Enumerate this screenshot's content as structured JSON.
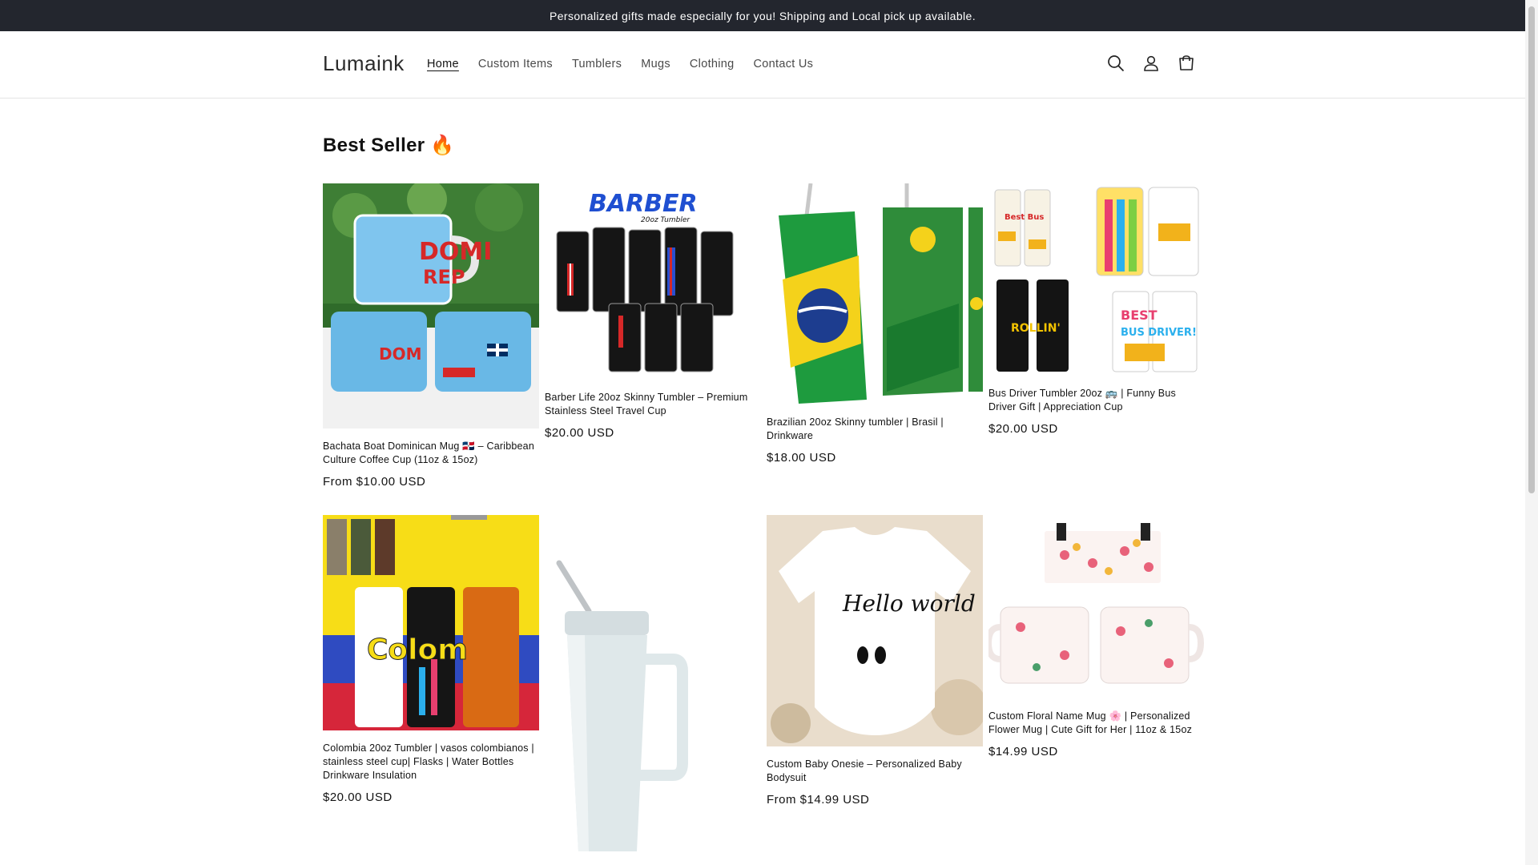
{
  "announcement": "Personalized gifts made especially for you! Shipping and Local pick up available.",
  "header": {
    "logo": "Lumaink",
    "nav": [
      "Home",
      "Custom Items",
      "Tumblers",
      "Mugs",
      "Clothing",
      "Contact Us"
    ],
    "icons": [
      "search-icon",
      "account-icon",
      "cart-icon"
    ]
  },
  "section": {
    "title": "Best Seller 🔥"
  },
  "products": [
    {
      "title": "Bachata Boat Dominican Mug 🇩🇴 – Caribbean Culture Coffee Cup (11oz & 15oz)",
      "price": "From $10.00 USD"
    },
    {
      "title": "Barber Life 20oz Skinny Tumbler – Premium Stainless Steel Travel Cup",
      "price": "$20.00 USD"
    },
    {
      "title": "Brazilian 20oz Skinny tumbler | Brasil | Drinkware",
      "price": "$18.00 USD"
    },
    {
      "title": "Bus Driver Tumbler 20oz 🚌 | Funny Bus Driver Gift | Appreciation Cup",
      "price": "$20.00 USD"
    },
    {
      "title": "Colombia 20oz Tumbler | vasos colombianos | stainless steel cup| Flasks | Water Bottles Drinkware Insulation",
      "price": "$20.00 USD"
    },
    {
      "title": "",
      "price": ""
    },
    {
      "title": "Custom Baby Onesie – Personalized Baby Bodysuit",
      "price": "From $14.99 USD"
    },
    {
      "title": "Custom Floral Name Mug 🌸 | Personalized Flower Mug | Cute Gift for Her | 11oz & 15oz",
      "price": "$14.99 USD"
    }
  ],
  "image_text": {
    "barber_banner": "BARBER",
    "barber_sub": "20oz Tumbler",
    "onesie": "Hello world",
    "colombia": "Colom"
  },
  "colors": {
    "announcement_bg": "#23262e",
    "text": "#121212"
  }
}
